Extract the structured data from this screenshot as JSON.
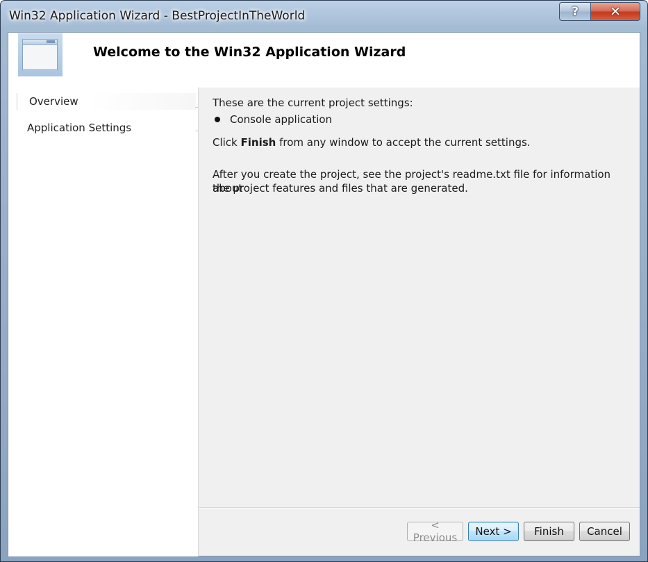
{
  "window": {
    "title": "Win32 Application Wizard - BestProjectInTheWorld",
    "help_label": "?",
    "close_label": "✕"
  },
  "header": {
    "title": "Welcome to the Win32 Application Wizard",
    "icon": "application-window-icon"
  },
  "sidebar": {
    "items": [
      {
        "label": "Overview",
        "selected": true
      },
      {
        "label": "Application Settings",
        "selected": false
      }
    ]
  },
  "content": {
    "intro": "These are the current project settings:",
    "settings": [
      "Console application"
    ],
    "finish_prefix": "Click ",
    "finish_bold": "Finish",
    "finish_suffix": " from any window to accept the current settings.",
    "readme_line1": "After you create the project, see the project's readme.txt file for information about",
    "readme_line2": "the project features and files that are generated."
  },
  "buttons": {
    "previous": "< Previous",
    "next": "Next >",
    "finish": "Finish",
    "cancel": "Cancel",
    "previous_enabled": false
  }
}
